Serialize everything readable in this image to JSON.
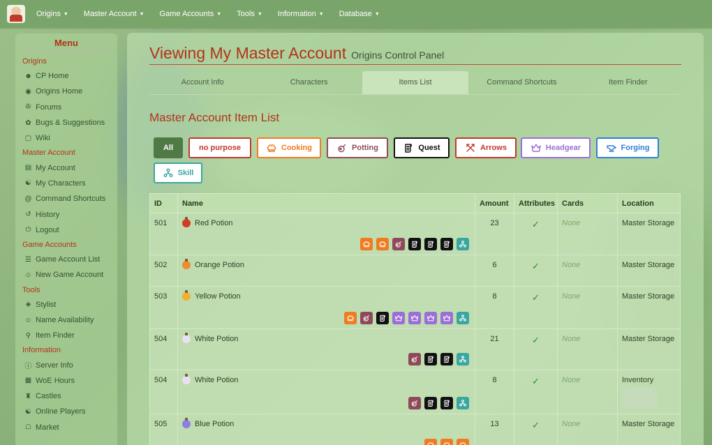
{
  "navbar": {
    "items": [
      {
        "label": "Origins"
      },
      {
        "label": "Master Account"
      },
      {
        "label": "Game Accounts"
      },
      {
        "label": "Tools"
      },
      {
        "label": "Information"
      },
      {
        "label": "Database"
      }
    ]
  },
  "sidebar": {
    "title": "Menu",
    "sections": [
      {
        "label": "Origins",
        "links": [
          {
            "label": "CP Home",
            "icon": "person-icon"
          },
          {
            "label": "Origins Home",
            "icon": "globe-icon"
          },
          {
            "label": "Forums",
            "icon": "chat-icon"
          },
          {
            "label": "Bugs & Suggestions",
            "icon": "bug-icon"
          },
          {
            "label": "Wiki",
            "icon": "monitor-icon"
          }
        ]
      },
      {
        "label": "Master Account",
        "links": [
          {
            "label": "My Account",
            "icon": "id-card-icon"
          },
          {
            "label": "My Characters",
            "icon": "people-icon"
          },
          {
            "label": "Command Shortcuts",
            "icon": "at-icon"
          },
          {
            "label": "History",
            "icon": "history-icon"
          },
          {
            "label": "Logout",
            "icon": "power-icon"
          }
        ]
      },
      {
        "label": "Game Accounts",
        "links": [
          {
            "label": "Game Account List",
            "icon": "list-icon"
          },
          {
            "label": "New Game Account",
            "icon": "person-add-icon"
          }
        ]
      },
      {
        "label": "Tools",
        "links": [
          {
            "label": "Stylist",
            "icon": "palette-icon"
          },
          {
            "label": "Name Availability",
            "icon": "person-check-icon"
          },
          {
            "label": "Item Finder",
            "icon": "search-icon"
          }
        ]
      },
      {
        "label": "Information",
        "links": [
          {
            "label": "Server Info",
            "icon": "info-icon"
          },
          {
            "label": "WoE Hours",
            "icon": "calendar-icon"
          },
          {
            "label": "Castles",
            "icon": "castle-icon"
          },
          {
            "label": "Online Players",
            "icon": "people-icon"
          },
          {
            "label": "Market",
            "icon": "shop-icon"
          }
        ]
      }
    ]
  },
  "header": {
    "title": "Viewing My Master Account",
    "subtitle": "Origins Control Panel"
  },
  "tabs": [
    {
      "label": "Account Info"
    },
    {
      "label": "Characters"
    },
    {
      "label": "Items List"
    },
    {
      "label": "Command Shortcuts"
    },
    {
      "label": "Item Finder"
    }
  ],
  "active_tab": "Items List",
  "section_title": "Master Account Item List",
  "filters": [
    {
      "label": "All",
      "color": "#4f7a46",
      "icon": ""
    },
    {
      "label": "no purpose",
      "color": "#c0392b",
      "icon": ""
    },
    {
      "label": "Cooking",
      "color": "#f07b20",
      "icon": "chef-hat-icon"
    },
    {
      "label": "Potting",
      "color": "#8e4a5a",
      "icon": "potion-icon"
    },
    {
      "label": "Quest",
      "color": "#111111",
      "icon": "scroll-icon"
    },
    {
      "label": "Arrows",
      "color": "#c0392b",
      "icon": "crossed-arrows-icon"
    },
    {
      "label": "Headgear",
      "color": "#9b6fd6",
      "icon": "crown-icon"
    },
    {
      "label": "Forging",
      "color": "#2f7fd8",
      "icon": "anvil-icon"
    },
    {
      "label": "Skill",
      "color": "#3aa6a0",
      "icon": "skill-tree-icon"
    }
  ],
  "table": {
    "columns": [
      "ID",
      "Name",
      "Amount",
      "Attributes",
      "Cards",
      "Location"
    ],
    "rows": [
      {
        "id": "501",
        "name": "Red Potion",
        "potion_color": "#d33b22",
        "amount": "23",
        "cards": "None",
        "location": "Master Storage",
        "tags": [
          "cooking",
          "cooking",
          "potting",
          "quest",
          "quest",
          "quest",
          "skill"
        ]
      },
      {
        "id": "502",
        "name": "Orange Potion",
        "potion_color": "#f08a30",
        "amount": "6",
        "cards": "None",
        "location": "Master Storage",
        "tags": []
      },
      {
        "id": "503",
        "name": "Yellow Potion",
        "potion_color": "#f0b030",
        "amount": "8",
        "cards": "None",
        "location": "Master Storage",
        "tags": [
          "cooking",
          "potting",
          "quest",
          "headgear",
          "headgear",
          "headgear",
          "headgear",
          "skill"
        ]
      },
      {
        "id": "504",
        "name": "White Potion",
        "potion_color": "#e8e2f0",
        "amount": "21",
        "cards": "None",
        "location": "Master Storage",
        "tags": [
          "potting",
          "quest",
          "quest",
          "skill"
        ]
      },
      {
        "id": "504",
        "name": "White Potion",
        "potion_color": "#e8e2f0",
        "amount": "8",
        "cards": "None",
        "location": "Inventory",
        "tags": [
          "potting",
          "quest",
          "quest",
          "skill"
        ]
      },
      {
        "id": "505",
        "name": "Blue Potion",
        "potion_color": "#8b7fe0",
        "amount": "13",
        "cards": "None",
        "location": "Master Storage",
        "tags": [
          "cooking",
          "cooking",
          "cooking"
        ]
      }
    ]
  },
  "tag_colors": {
    "cooking": "#f07b20",
    "potting": "#8e4a5a",
    "quest": "#111111",
    "headgear": "#9b6fd6",
    "skill": "#3aa6a0"
  }
}
